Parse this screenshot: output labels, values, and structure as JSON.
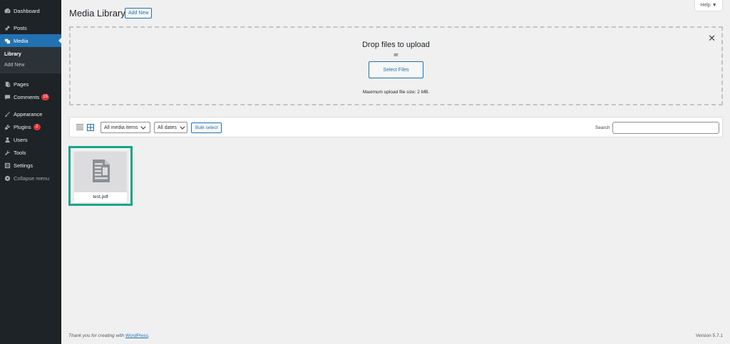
{
  "sidebar": {
    "items": [
      {
        "label": "Dashboard",
        "icon": "dashboard-icon"
      },
      {
        "label": "Posts",
        "icon": "pin-icon"
      },
      {
        "label": "Media",
        "icon": "media-icon"
      },
      {
        "label": "Pages",
        "icon": "pages-icon"
      },
      {
        "label": "Comments",
        "icon": "comment-icon",
        "badge": "15"
      },
      {
        "label": "Appearance",
        "icon": "brush-icon"
      },
      {
        "label": "Plugins",
        "icon": "plugin-icon",
        "badge": "2"
      },
      {
        "label": "Users",
        "icon": "user-icon"
      },
      {
        "label": "Tools",
        "icon": "wrench-icon"
      },
      {
        "label": "Settings",
        "icon": "settings-icon"
      },
      {
        "label": "Collapse menu",
        "icon": "collapse-icon"
      }
    ],
    "submenu": [
      "Library",
      "Add New"
    ]
  },
  "header": {
    "title": "Media Library",
    "add_new": "Add New",
    "help": "Help ▼"
  },
  "uploader": {
    "title": "Drop files to upload",
    "or": "or",
    "button": "Select Files",
    "max_size": "Maximum upload file size: 2 MB."
  },
  "toolbar": {
    "filter_type": "All media items",
    "filter_date": "All dates",
    "bulk_select": "Bulk select",
    "search_label": "Search",
    "search_value": ""
  },
  "attachments": [
    {
      "filename": "test.pdf",
      "icon": "document-icon"
    }
  ],
  "footer": {
    "thanks_prefix": "Thank you for creating with ",
    "thanks_link": "WordPress",
    "thanks_suffix": ".",
    "version": "Version 5.7.1"
  },
  "colors": {
    "sidebar_bg": "#1d2327",
    "accent": "#2271b1",
    "selection_border": "#17a589",
    "badge": "#d63638"
  }
}
